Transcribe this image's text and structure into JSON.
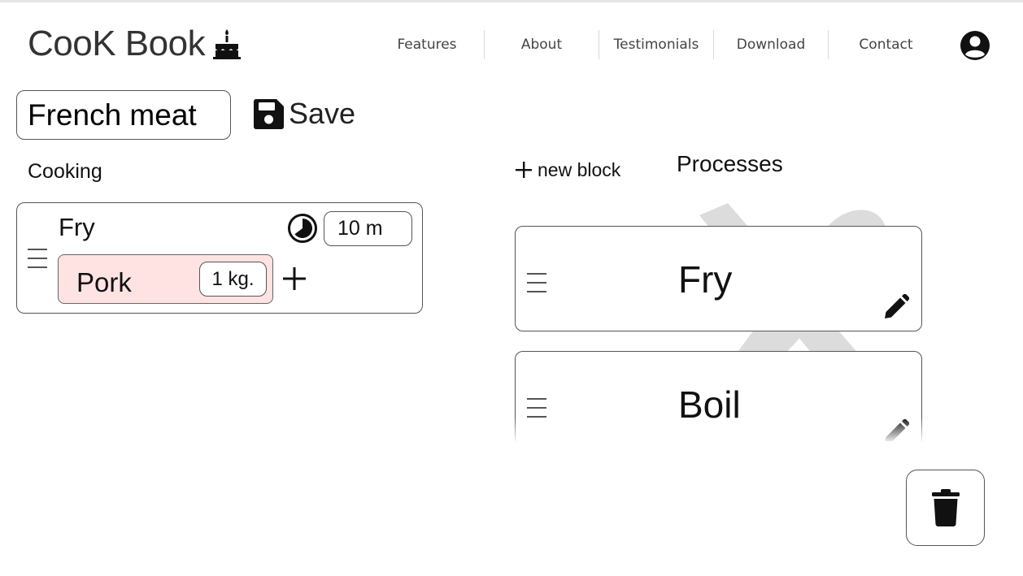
{
  "brand": {
    "name": "CooK Book"
  },
  "nav": {
    "items": [
      {
        "label": "Features"
      },
      {
        "label": "About"
      },
      {
        "label": "Testimonials"
      },
      {
        "label": "Download"
      },
      {
        "label": "Contact"
      }
    ]
  },
  "recipe": {
    "title_value": "French meat",
    "save_label": "Save"
  },
  "cooking": {
    "section_label": "Cooking",
    "blocks": [
      {
        "title": "Fry",
        "time": "10 m",
        "ingredients": [
          {
            "name": "Pork",
            "qty": "1 kg."
          }
        ]
      }
    ]
  },
  "processes": {
    "new_block_label": "new block",
    "title": "Processes",
    "items": [
      {
        "name": "Fry"
      },
      {
        "name": "Boil"
      }
    ]
  },
  "icons": {
    "logo": "cake-icon",
    "account": "user-circle-icon",
    "save": "floppy-disk-icon",
    "timer": "clock-icon",
    "add": "plus-icon",
    "edit": "pencil-icon",
    "delete": "trash-icon",
    "drag": "drag-handle-icon"
  },
  "colors": {
    "ingredient_bg": "#ffe3e3",
    "border": "#555555",
    "text": "#111111"
  }
}
